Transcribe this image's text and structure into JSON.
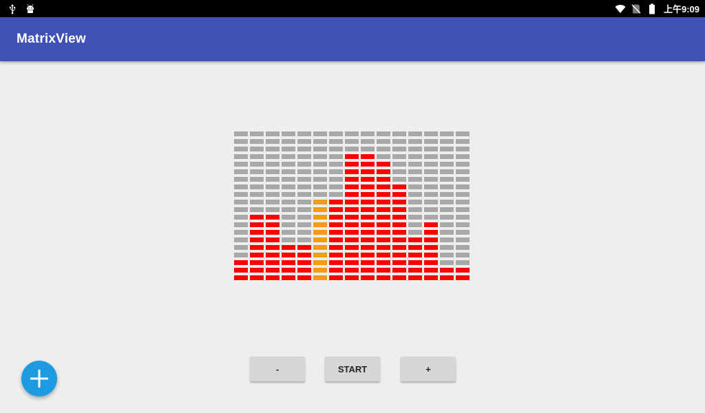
{
  "status_bar": {
    "time": "上午9:09",
    "icons": [
      "usb-icon",
      "android-debug-icon",
      "wifi-icon",
      "no-sim-icon",
      "battery-icon"
    ]
  },
  "app_bar": {
    "title": "MatrixView"
  },
  "matrix": {
    "rows": 20,
    "columns": 15,
    "column_levels": [
      3,
      9,
      9,
      5,
      5,
      11,
      11,
      17,
      17,
      16,
      13,
      6,
      8,
      2,
      2
    ],
    "highlighted_column": 5,
    "colors": {
      "off": "#a8a8a8",
      "on": "#ff0000",
      "highlight": "#f39c12"
    }
  },
  "controls": {
    "minus_label": "-",
    "start_label": "START",
    "plus_label": "+"
  },
  "fab": {
    "icon": "plus-icon",
    "color": "#1e9be0"
  }
}
